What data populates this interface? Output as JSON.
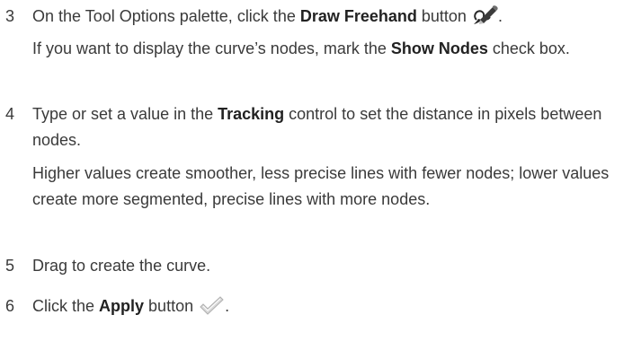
{
  "steps": [
    {
      "number": "3",
      "pre": "On the Tool Options palette, click the ",
      "bold": "Draw Freehand",
      "post": " button ",
      "icon": "draw-freehand-icon",
      "tail": ".",
      "note": {
        "pre": "If you want to display the curve’s nodes, mark the ",
        "bold": "Show Nodes",
        "post": " check box."
      }
    },
    {
      "number": "4",
      "pre": "Type or set a value in the ",
      "bold": "Tracking",
      "post": " control to set the distance in pixels between nodes.",
      "note": {
        "text": "Higher values create smoother, less precise lines with fewer nodes; lower values create more segmented, precise lines with more nodes."
      }
    },
    {
      "number": "5",
      "text": "Drag to create the curve."
    },
    {
      "number": "6",
      "pre": "Click the ",
      "bold": "Apply",
      "post": " button ",
      "icon": "apply-checkmark-icon",
      "tail": "."
    }
  ]
}
